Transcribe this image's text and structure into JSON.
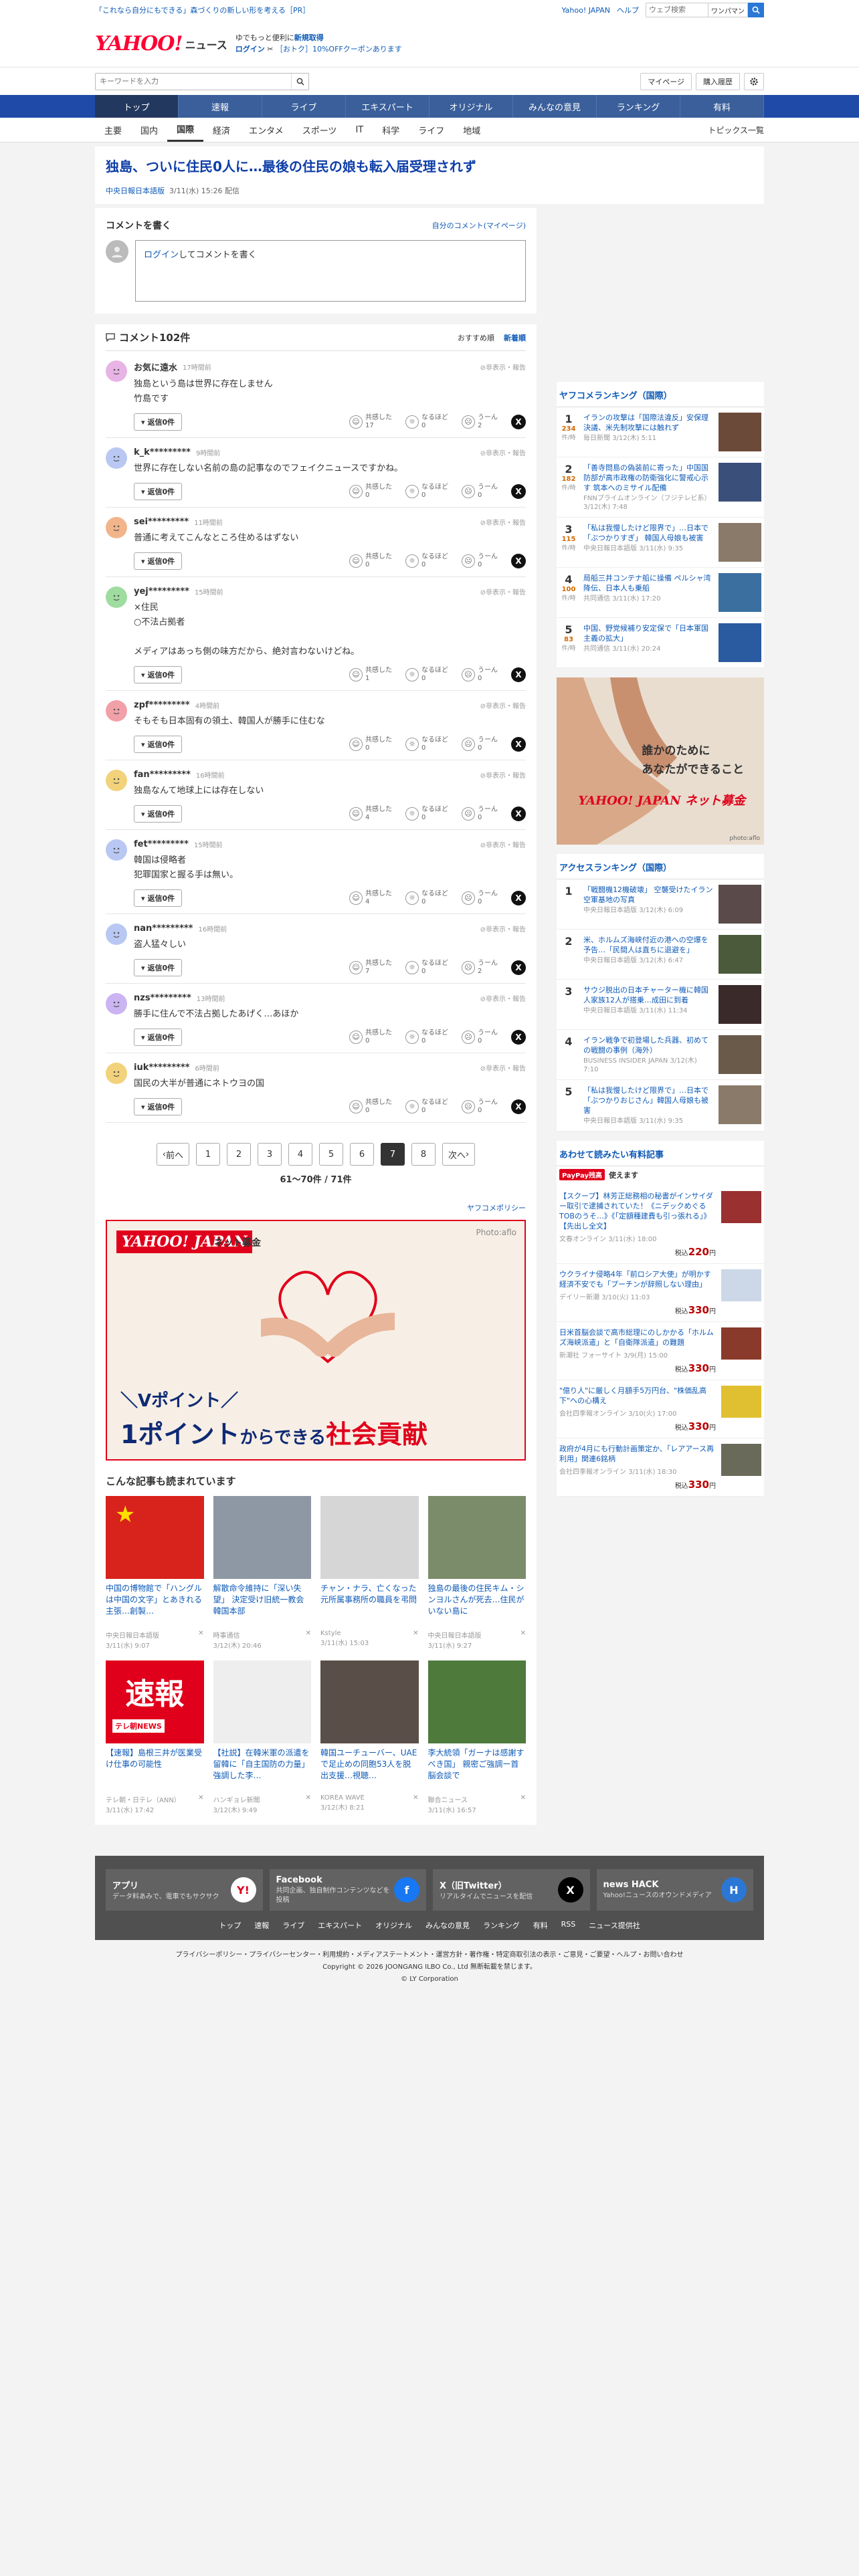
{
  "topbar": {
    "promo": "「これなら自分にもできる」森づくりの新しい形を考える［PR］",
    "yahoo_japan": "Yahoo! JAPAN",
    "help": "ヘルプ",
    "search_placeholder": "ウェブ検索",
    "select_label": "ワンパマン"
  },
  "header": {
    "logo_yahoo": "YAHOO!",
    "logo_sub": "JAPAN",
    "logo_news": "ニュース",
    "promo_line1": "ゆでもっと便利に",
    "promo_line1_b": "新規取得",
    "login": "ログイン",
    "promo_line2": "［おトク］10%OFFクーポンあります"
  },
  "search": {
    "placeholder": "キーワードを入力",
    "mypage": "マイページ",
    "history": "購入履歴"
  },
  "nav": [
    "トップ",
    "速報",
    "ライブ",
    "エキスパート",
    "オリジナル",
    "みんなの意見",
    "ランキング",
    "有料"
  ],
  "subnav": [
    "主要",
    "国内",
    "国際",
    "経済",
    "エンタメ",
    "スポーツ",
    "IT",
    "科学",
    "ライフ",
    "地域"
  ],
  "subnav_right": "トピックス一覧",
  "article": {
    "title": "独島、ついに住民0人に…最後の住民の娘も転入届受理されず",
    "source": "中央日報日本語版",
    "date": "3/11(水) 15:26 配信"
  },
  "comment_write": {
    "title": "コメントを書く",
    "my_comments": "自分のコメント(マイページ)",
    "login_link": "ログイン",
    "prompt": "してコメントを書く"
  },
  "comments_head": {
    "count": "コメント102件",
    "sort_recommended": "おすすめ順",
    "sort_newest": "新着順"
  },
  "report_label": "非表示・報告",
  "reply_label": "返信0件",
  "react_labels": [
    "共感した",
    "なるほど",
    "うーん"
  ],
  "comments": [
    {
      "user": "お気に遠水",
      "time": "17時間前",
      "text": "独島という島は世界に存在しません\n竹島です",
      "empathy": "17",
      "naruhodo": "0",
      "un": "2",
      "color": "#e8b4e6"
    },
    {
      "user": "k_k*********",
      "time": "9時間前",
      "text": "世界に存在しない名前の島の記事なのでフェイクニュースですかね。",
      "empathy": "0",
      "naruhodo": "0",
      "un": "0",
      "color": "#b9c8f2"
    },
    {
      "user": "sei*********",
      "time": "11時間前",
      "text": "普通に考えてこんなところ住めるはずない",
      "empathy": "0",
      "naruhodo": "0",
      "un": "0",
      "color": "#f2b48a"
    },
    {
      "user": "yej*********",
      "time": "15時間前",
      "text": "×住民\n○不法占拠者\n\nメディアはあっち側の味方だから、絶対言わないけどね。",
      "empathy": "1",
      "naruhodo": "0",
      "un": "0",
      "color": "#9fdc9f"
    },
    {
      "user": "zpf*********",
      "time": "4時間前",
      "text": "そもそも日本固有の領土、韓国人が勝手に住むな",
      "empathy": "0",
      "naruhodo": "0",
      "un": "0",
      "color": "#f2a0a8"
    },
    {
      "user": "fan*********",
      "time": "16時間前",
      "text": "独島なんて地球上には存在しない",
      "empathy": "4",
      "naruhodo": "0",
      "un": "0",
      "color": "#f2d27a"
    },
    {
      "user": "fet*********",
      "time": "15時間前",
      "text": "韓国は侵略者\n犯罪国家と握る手は無い。",
      "empathy": "4",
      "naruhodo": "0",
      "un": "0",
      "color": "#b9c8f2"
    },
    {
      "user": "nan*********",
      "time": "16時間前",
      "text": "盗人猛々しい",
      "empathy": "7",
      "naruhodo": "0",
      "un": "2",
      "color": "#b9c8f2"
    },
    {
      "user": "nzs*********",
      "time": "13時間前",
      "text": "勝手に住んで不法占拠したあげく…あほか",
      "empathy": "0",
      "naruhodo": "0",
      "un": "0",
      "color": "#cbb4f2"
    },
    {
      "user": "iuk*********",
      "time": "6時間前",
      "text": "国民の大半が普通にネトウヨの国",
      "empathy": "0",
      "naruhodo": "0",
      "un": "0",
      "color": "#f2d27a"
    }
  ],
  "pager": {
    "prev": "前へ",
    "next": "次へ",
    "pages": [
      "1",
      "2",
      "3",
      "4",
      "5",
      "6",
      "7",
      "8"
    ],
    "current": "7",
    "count": "61〜70件 / 71件"
  },
  "policy": "ヤフコメポリシー",
  "ad_banner": {
    "logo": "YAHOO! JAPAN",
    "logo_sub": "ネット募金",
    "photo": "Photo:aflo",
    "copy1": "＼Vポイント／",
    "copy2a": "1ポイント",
    "copy2b": "からできる",
    "copy2c": "社会貢献"
  },
  "recommended": {
    "title": "こんな記事も読まれています",
    "items": [
      {
        "caption": "中国の博物館で「ハングルは中国の文字」とあきれる主張…創製…",
        "source": "中央日報日本語版",
        "date": "3/11(水) 9:07",
        "bg": "#d8221c",
        "sub": ""
      },
      {
        "caption": "解散命令維持に「深い失望」 決定受け旧統一教会韓国本部",
        "source": "時事通信",
        "date": "3/12(木) 20:46",
        "bg": "#8d98a4",
        "sub": ""
      },
      {
        "caption": "チャン・ナラ、亡くなった元所属事務所の職員を弔問",
        "source": "Kstyle",
        "date": "3/11(水) 15:03",
        "bg": "#d6d6d6",
        "sub": ""
      },
      {
        "caption": "独島の最後の住民キム・シンヨルさんが死去…住民がいない島に",
        "source": "中央日報日本語版",
        "date": "3/11(水) 9:27",
        "bg": "#7b8c6a",
        "sub": ""
      },
      {
        "caption": "【速報】島根三井が医業受け仕事の可能性",
        "source": "テレ朝・日テレ（ANN）",
        "date": "3/11(水) 17:42",
        "bg": "#e0001b",
        "sub": "テレ朝NEWS"
      },
      {
        "caption": "【社説】在韓米軍の派遣を留韓に「自主国防の力量」強調した李…",
        "source": "ハンギョレ新聞",
        "date": "3/12(木) 9:49",
        "bg": "#eeeeee",
        "sub": ""
      },
      {
        "caption": "韓国ユーチューバー、UAEで足止めの同胞53人を脱出支援…視聴…",
        "source": "KOREA WAVE",
        "date": "3/12(木) 8:21",
        "bg": "#5a4f48",
        "sub": ""
      },
      {
        "caption": "李大統領「ガーナは感謝すべき国」 親密ご強調ー首脳会談で",
        "source": "聯合ニュース",
        "date": "3/11(水) 16:57",
        "bg": "#4e7a3c",
        "sub": ""
      }
    ]
  },
  "ranking": {
    "title": "ヤフコメランキング（国際）",
    "unit": "件/時",
    "items": [
      {
        "title": "イランの攻撃は「国際法違反」安保理決議、米先制攻撃には触れず",
        "source": "毎日新聞",
        "date": "3/12(木) 5:11",
        "count": "234",
        "thumb": "#6c4a3a"
      },
      {
        "title": "「善寺問島の偽装前に寄った」中国国防部が高市政権の防衛強化に警戒心示す 筑本へのミサイル配備",
        "source": "FNNプライムオンライン（フジテレビ系）",
        "date": "3/12(木) 7:48",
        "count": "182",
        "thumb": "#3a4f7a"
      },
      {
        "title": "「私は我慢したけど限界で」…日本で「ぶつかりすぎ」 韓国人母娘も被害",
        "source": "中央日報日本語版",
        "date": "3/11(水) 9:35",
        "count": "115",
        "thumb": "#8a7a6a"
      },
      {
        "title": "局船三井コンテナ船に操備 ペルシャ湾降伝、日本人も乗船",
        "source": "共同通信",
        "date": "3/11(水) 17:20",
        "count": "100",
        "thumb": "#3a6fa0"
      },
      {
        "title": "中国、野党候補り安定保で「日本軍国主義の拡大」",
        "source": "共同通信",
        "date": "3/11(水) 20:24",
        "count": "83",
        "thumb": "#2a5aa0"
      }
    ]
  },
  "side_ad": {
    "line1": "誰かのために",
    "line2": "あなたができること",
    "logo": "YAHOO! JAPAN ネット募金",
    "photo": "photo:aflo"
  },
  "access_ranking": {
    "title": "アクセスランキング（国際）",
    "items": [
      {
        "title": "「戦闘機12機破壊」 空襲受けたイラン空軍基地の写真",
        "source": "中央日報日本語版",
        "date": "3/12(木) 6:09",
        "thumb": "#5a4a4a"
      },
      {
        "title": "米、ホルムズ海峡付近の港への空爆を予告…「民間人は直ちに退避を」",
        "source": "中央日報日本語版",
        "date": "3/12(木) 6:47",
        "thumb": "#4a5a3a"
      },
      {
        "title": "サウジ脱出の日本チャーター機に韓国人家族12人が搭乗…成田に到着",
        "source": "中央日報日本語版",
        "date": "3/11(水) 11:34",
        "thumb": "#3a2a2a"
      },
      {
        "title": "イラン戦争で初登場した兵器、初めての戦闘の事例（海外）",
        "source": "BUSINESS INSIDER JAPAN",
        "date": "3/12(木) 7:10",
        "thumb": "#6a5a4a"
      },
      {
        "title": "「私は我慢したけど限界で」…日本で「ぶつかりおじさん」韓国人母娘も被害",
        "source": "中央日報日本語版",
        "date": "3/11(水) 9:35",
        "thumb": "#8a7a6a"
      }
    ]
  },
  "paid": {
    "title": "あわせて読みたい有料記事",
    "paypay": "PayPay残高",
    "paypay_text": "使えます",
    "items": [
      {
        "title": "【スクープ】林芳正総務相の秘書がインサイダー取引で逮捕されていた！《ニデックめぐるTOBのうそ…》《「定額種建費も引っ張れる」》【先出し全文】",
        "source": "文春オンライン",
        "date": "3/11(水) 18:00",
        "price": "220",
        "thumb": "#9a3030"
      },
      {
        "title": "ウクライナ侵略4年「前ロシア大使」が明かす　経済不安でも「プーチンが辞照しない理由」",
        "source": "デイリー新潮",
        "date": "3/10(火) 11:03",
        "price": "330",
        "thumb": "#ccd8e8"
      },
      {
        "title": "日米首脳会談で高市総理にのしかかる「ホルムズ海峡派遣」と「自衛隊派遣」の難題",
        "source": "新潮社 フォーサイト",
        "date": "3/9(月) 15:00",
        "price": "330",
        "thumb": "#8a3a2a"
      },
      {
        "title": "\"億り人\"に厳しく月額手5万円台、\"株価乱高下\"への心構え",
        "source": "会社四季報オンライン",
        "date": "3/10(火) 17:00",
        "price": "330",
        "thumb": "#e0c030"
      },
      {
        "title": "政府が4月にも行動計画策定か、「レアアース再利用」関連6銘柄",
        "source": "会社四季報オンライン",
        "date": "3/11(水) 18:30",
        "price": "330",
        "thumb": "#6a6a5a"
      }
    ],
    "tax": "税込"
  },
  "footer": {
    "apps": [
      {
        "name": "アプリ",
        "desc": "データ料あみで、電車でもサクサク",
        "icon": "Y!",
        "bg": "#ffffff",
        "fg": "#e0001b"
      },
      {
        "name": "Facebook",
        "desc": "共同企画、独自制作コンテンツなどを投稿",
        "icon": "f",
        "bg": "#1877f2",
        "fg": "#ffffff"
      },
      {
        "name": "X（旧Twitter）",
        "desc": "リアルタイムでニュースを配信",
        "icon": "X",
        "bg": "#000000",
        "fg": "#ffffff"
      },
      {
        "name": "news HACK",
        "desc": "Yahoo!ニュースのオウンドメディア",
        "icon": "H",
        "bg": "#2a77d6",
        "fg": "#ffffff"
      }
    ],
    "links": [
      "トップ",
      "速報",
      "ライブ",
      "エキスパート",
      "オリジナル",
      "みんなの意見",
      "ランキング",
      "有料",
      "RSS",
      "ニュース提供社"
    ],
    "policy_links": "プライバシーポリシー・プライバシーセンター・利用規約・メディアステートメント・運営方針・著作権・特定商取引法の表示・ご意見・ご要望・ヘルプ・お問い合わせ",
    "copyright": "Copyright © 2026 JOONGANG ILBO Co., Ltd 無断転載を禁じます。",
    "corp": "© LY Corporation"
  }
}
